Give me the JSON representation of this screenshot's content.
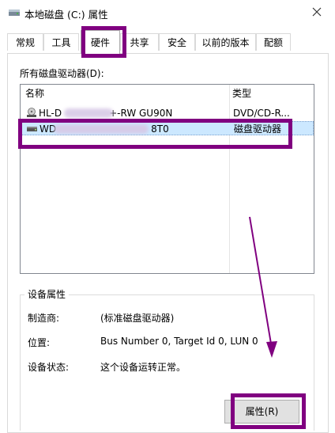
{
  "window": {
    "title": "本地磁盘 (C:) 属性",
    "close_label": "✕"
  },
  "tabs": [
    {
      "label": "常规"
    },
    {
      "label": "工具"
    },
    {
      "label": "硬件",
      "active": true
    },
    {
      "label": "共享"
    },
    {
      "label": "安全"
    },
    {
      "label": "以前的版本"
    },
    {
      "label": "配额"
    }
  ],
  "drives": {
    "label": "所有磁盘驱动器(D):",
    "columns": {
      "name": "名称",
      "type": "类型"
    },
    "rows": [
      {
        "name_prefix": "HL-D",
        "name_suffix": "+-RW GU90N",
        "type": "DVD/CD-R...",
        "icon": "optical-drive-icon"
      },
      {
        "name_prefix": "WD",
        "name_suffix": "8T0",
        "type": "磁盘驱动器",
        "icon": "disk-drive-icon",
        "selected": true
      }
    ]
  },
  "device_properties": {
    "title": "设备属性",
    "manufacturer_label": "制造商:",
    "manufacturer_value": "(标准磁盘驱动器)",
    "location_label": "位置:",
    "location_value": "Bus Number 0, Target Id 0, LUN 0",
    "status_label": "设备状态:",
    "status_value": "这个设备运转正常。",
    "properties_button": "属性(R)"
  },
  "colors": {
    "annotation": "#800080",
    "selection": "#cce8ff"
  }
}
